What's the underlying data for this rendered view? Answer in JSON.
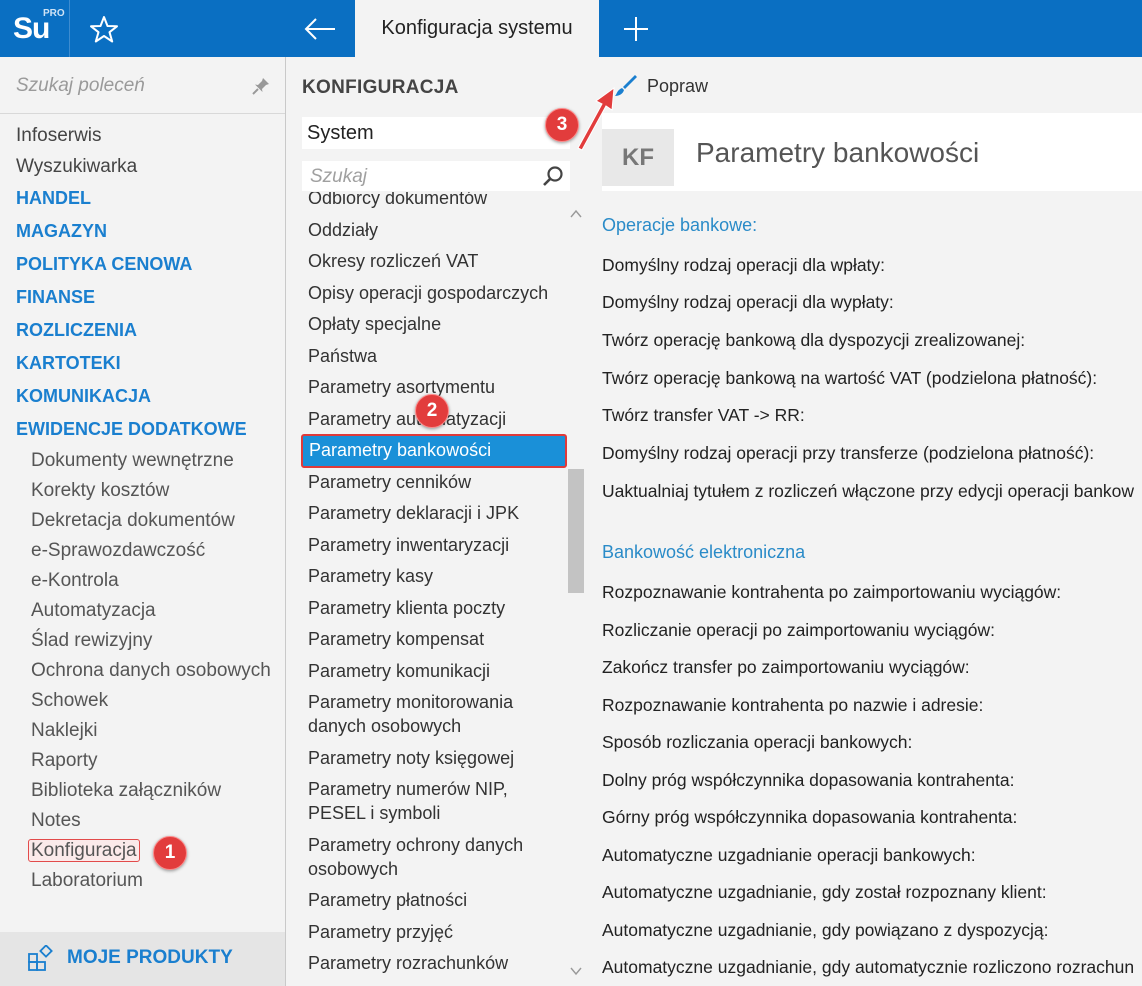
{
  "app": {
    "logo_main": "Su",
    "logo_sup": "PRO",
    "active_tab": "Konfiguracja systemu",
    "icons": {
      "favorite": "star-icon",
      "back": "arrow-left-icon",
      "new_tab": "plus-icon"
    }
  },
  "sidebar": {
    "search_placeholder": "Szukaj poleceń",
    "top_items": [
      "Infoserwis",
      "Wyszukiwarka"
    ],
    "sections": [
      "HANDEL",
      "MAGAZYN",
      "POLITYKA CENOWA",
      "FINANSE",
      "ROZLICZENIA",
      "KARTOTEKI",
      "KOMUNIKACJA",
      "EWIDENCJE DODATKOWE"
    ],
    "sub_items": [
      "Dokumenty wewnętrzne",
      "Korekty kosztów",
      "Dekretacja dokumentów",
      "e-Sprawozdawczość",
      "e-Kontrola",
      "Automatyzacja",
      "Ślad rewizyjny",
      "Ochrona danych osobowych",
      "Schowek",
      "Naklejki",
      "Raporty",
      "Biblioteka załączników",
      "Notes",
      "Konfiguracja",
      "Laboratorium"
    ],
    "my_products": "MOJE PRODUKTY"
  },
  "middle": {
    "heading": "KONFIGURACJA",
    "selected_group": "System",
    "search_placeholder": "Szukaj",
    "items": [
      "Odbiorcy dokumentów",
      "Oddziały",
      "Okresy rozliczeń VAT",
      "Opisy operacji gospodarczych",
      "Opłaty specjalne",
      "Państwa",
      "Parametry asortymentu",
      "Parametry automatyzacji",
      "Parametry bankowości",
      "Parametry cenników",
      "Parametry deklaracji i JPK",
      "Parametry inwentaryzacji",
      "Parametry kasy",
      "Parametry klienta poczty",
      "Parametry kompensat",
      "Parametry komunikacji",
      "Parametry monitorowania danych osobowych",
      "Parametry noty księgowej",
      "Parametry numerów NIP, PESEL i symboli",
      "Parametry ochrony danych osobowych",
      "Parametry płatności",
      "Parametry przyjęć",
      "Parametry rozrachunków"
    ],
    "selected_item": "Parametry bankowości"
  },
  "content": {
    "action_label": "Popraw",
    "badge": "KF",
    "title": "Parametry bankowości",
    "section1_title": "Operacje bankowe:",
    "section1_params": [
      "Domyślny rodzaj operacji dla wpłaty:",
      "Domyślny rodzaj operacji dla wypłaty:",
      "Twórz operację bankową dla dyspozycji zrealizowanej:",
      "Twórz operację bankową na wartość VAT (podzielona płatność):",
      "Twórz transfer VAT -> RR:",
      "Domyślny rodzaj operacji przy transferze (podzielona płatność):",
      "Uaktualniaj tytułem z rozliczeń włączone przy edycji operacji bankow"
    ],
    "section2_title": "Bankowość elektroniczna",
    "section2_params": [
      "Rozpoznawanie kontrahenta po zaimportowaniu wyciągów:",
      "Rozliczanie operacji po zaimportowaniu wyciągów:",
      "Zakończ transfer po zaimportowaniu wyciągów:",
      "Rozpoznawanie kontrahenta po nazwie i adresie:",
      "Sposób rozliczania operacji bankowych:",
      "Dolny próg współczynnika dopasowania kontrahenta:",
      "Górny próg współczynnika dopasowania kontrahenta:",
      "Automatyczne uzgadnianie operacji bankowych:",
      "Automatyczne uzgadnianie, gdy został rozpoznany klient:",
      "Automatyczne uzgadnianie, gdy powiązano z dyspozycją:",
      "Automatyczne uzgadnianie, gdy automatycznie rozliczono rozrachun"
    ]
  },
  "callouts": [
    "1",
    "2",
    "3"
  ],
  "colors": {
    "topbar": "#0a6fc2",
    "accent": "#1a7fcf",
    "selection": "#1a90d8",
    "callout": "#e23c3c"
  }
}
